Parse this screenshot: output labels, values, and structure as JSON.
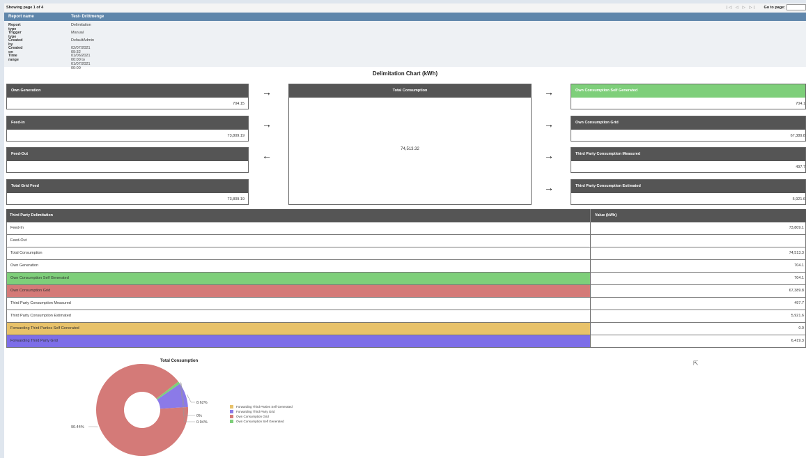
{
  "topbar": {
    "page_info": "Showing page  1  of  4",
    "nav_icons": "|◁ ◁ ▷ ▷|",
    "goto_label": "Go to page:"
  },
  "report": {
    "name_label": "Report name",
    "name_value": "Test- Drittmenge",
    "rows": [
      {
        "k": "Report type",
        "v": "Delimitation"
      },
      {
        "k": "Trigger type",
        "v": "Manual"
      },
      {
        "k": "Created by",
        "v": "DefaultAdmin"
      },
      {
        "k": "Created on",
        "v": "02/07/2021 09:32"
      },
      {
        "k": "Time range",
        "v": "01/06/2021 00:00 to 01/07/2021 00:00"
      }
    ]
  },
  "delim": {
    "title": "Delimitation Chart (kWh)",
    "left": [
      {
        "label": "Own Generation",
        "value": "704.15"
      },
      {
        "label": "Feed-In",
        "value": "73,809.19"
      },
      {
        "label": "Feed-Out",
        "value": ""
      },
      {
        "label": "Total Grid Feed",
        "value": "73,809.19"
      }
    ],
    "total": {
      "label": "Total Consumption",
      "value": "74,513.32"
    },
    "right": [
      {
        "label": "Own Consumption Self Generated",
        "value": "704.1"
      },
      {
        "label": "Own Consumption Grid",
        "value": "67,389.8"
      },
      {
        "label": "Third Party Consumption Measured",
        "value": "497.7"
      },
      {
        "label": "Third Party Consumption Estimated",
        "value": "5,921.6"
      }
    ],
    "arrows_left": [
      "→",
      "→",
      "←"
    ],
    "arrows_right": [
      "→",
      "→",
      "→",
      "→"
    ]
  },
  "table": {
    "col1": "Third Party Delimitation",
    "col2": "Value (kWh)",
    "rows": [
      {
        "label": "Feed-In",
        "value": "73,809.1",
        "color": "#ffffff"
      },
      {
        "label": "Feed-Out",
        "value": "",
        "color": "#ffffff"
      },
      {
        "label": "Total Consumption",
        "value": "74,513.3",
        "color": "#ffffff"
      },
      {
        "label": "Own Generation",
        "value": "704.1",
        "color": "#ffffff"
      },
      {
        "label": "Own Consumption Self Generated",
        "value": "704.1",
        "color": "#7ecf7a"
      },
      {
        "label": "Own Consumption Grid",
        "value": "67,389.8",
        "color": "#d47a78"
      },
      {
        "label": "Third Party Consumption Measured",
        "value": "497.7",
        "color": "#ffffff"
      },
      {
        "label": "Third Party Consumption Estimated",
        "value": "5,921.6",
        "color": "#ffffff"
      },
      {
        "label": "Forwarding Third Parties Self Generated",
        "value": "0.0",
        "color": "#e8c26a"
      },
      {
        "label": "Forwarding Third Party Grid",
        "value": "6,419.3",
        "color": "#7d6ee8"
      }
    ]
  },
  "chart_data": {
    "type": "pie",
    "title": "Total Consumption",
    "slices": [
      {
        "name": "Forwarding Third Parties Self Generated",
        "value": 0,
        "label": "0%",
        "color": "#e8c26a"
      },
      {
        "name": "Forwarding Third Party Grid",
        "value": 8.62,
        "label": "8.62%",
        "color": "#8b7ae8"
      },
      {
        "name": "Own Consumption Grid",
        "value": 90.44,
        "label": "90.44%",
        "color": "#d47a78"
      },
      {
        "name": "Own Consumption Self Generated",
        "value": 0.94,
        "label": "0.94%",
        "color": "#7ecf7a"
      }
    ],
    "legend_position": "right",
    "donut": true
  }
}
